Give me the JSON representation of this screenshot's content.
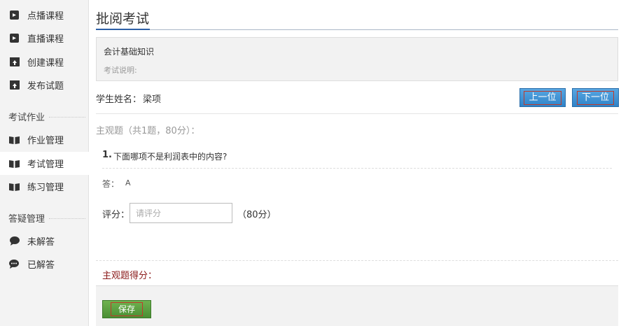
{
  "sidebar": {
    "items_top": [
      {
        "label": "点播课程",
        "icon": "video-camera-icon"
      },
      {
        "label": "直播课程",
        "icon": "video-camera-icon"
      },
      {
        "label": "创建课程",
        "icon": "upload-box-icon"
      },
      {
        "label": "发布试题",
        "icon": "upload-box-icon"
      }
    ],
    "group_exam": "考试作业",
    "items_exam": [
      {
        "label": "作业管理",
        "icon": "open-book-icon"
      },
      {
        "label": "考试管理",
        "icon": "open-book-icon",
        "active": true
      },
      {
        "label": "练习管理",
        "icon": "open-book-icon"
      }
    ],
    "group_qa": "答疑管理",
    "items_qa": [
      {
        "label": "未解答",
        "icon": "speech-bubble-icon"
      },
      {
        "label": "已解答",
        "icon": "speech-bubbles-icon"
      }
    ]
  },
  "page": {
    "title": "批阅考试",
    "exam_name": "会计基础知识",
    "exam_desc_label": "考试说明:",
    "student_label": "学生姓名：",
    "student_name": "梁项",
    "prev_label": "上一位",
    "next_label": "下一位",
    "section_title": "主观题（共1题，80分）：",
    "question_number": "1.",
    "question_text": "下面哪项不是利润表中的内容?",
    "answer_label": "答：",
    "answer_value": "A",
    "score_label": "评分：",
    "score_placeholder": "请评分",
    "score_value": "",
    "score_max": "（80分）",
    "subjective_score_label": "主观题得分：",
    "save_label": "保存"
  },
  "colors": {
    "blue_button": "#2f83c8",
    "green_button": "#4a8f34",
    "score_label": "#8b1a1a",
    "title_accent": "#2d5fa6"
  }
}
